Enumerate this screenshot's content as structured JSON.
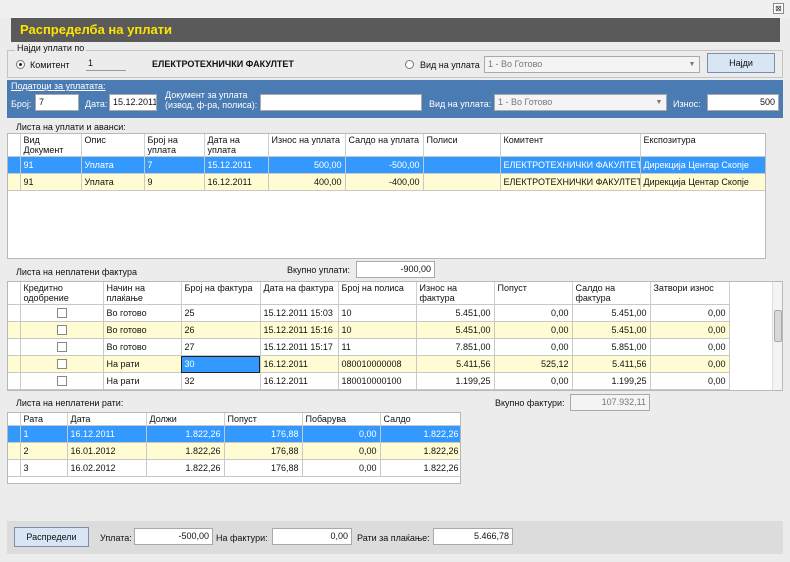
{
  "window": {
    "title": "Распределба на уплати",
    "close": "⊠"
  },
  "search": {
    "group_label": "Најди уплати по",
    "komitent_label": "Комитент",
    "komitent_code": "1",
    "komitent_name": "ЕЛЕКТРОТЕХНИЧКИ ФАКУЛТЕТ",
    "vid_label": "Вид на уплата",
    "vid_value": "1 - Во Готово",
    "find_button": "Најди"
  },
  "payment_data": {
    "link": "Податоци за уплатата:",
    "broj_label": "Број:",
    "broj_value": "7",
    "datum_label": "Дата:",
    "datum_value": "15.12.2011",
    "dokument_label_1": "Документ за уплата",
    "dokument_label_2": "(извод, ф-ра, полиса):",
    "dokument_value": "",
    "vid_label": "Вид на уплата:",
    "vid_value": "1 - Во Готово",
    "iznos_label": "Износ:",
    "iznos_value": "500"
  },
  "payments": {
    "title": "Листа на уплати и аванси:",
    "columns": [
      "Вид Документ",
      "Опис",
      "Број на уплата",
      "Дата на уплата",
      "Износ на уплата",
      "Салдо на уплата",
      "Полиси",
      "Комитент",
      "Експозитура"
    ],
    "rows": [
      [
        "91",
        "Уплата",
        "7",
        "15.12.2011",
        "500,00",
        "-500,00",
        "",
        "ЕЛЕКТРОТЕХНИЧКИ ФАКУЛТЕТ",
        "Дирекција Центар Скопје"
      ],
      [
        "91",
        "Уплата",
        "9",
        "16.12.2011",
        "400,00",
        "-400,00",
        "",
        "ЕЛЕКТРОТЕХНИЧКИ ФАКУЛТЕТ",
        "Дирекција Центар Скопје"
      ]
    ]
  },
  "invoices": {
    "title": "Листа на неплатени фактура",
    "total_payments_label": "Вкупно уплати:",
    "total_payments_value": "-900,00",
    "columns": [
      "Кредитно одобрение",
      "Начин на плаќање",
      "Број на фактура",
      "Дата на фактура",
      "Број на полиса",
      "Износ на фактура",
      "Попуст",
      "Салдо на фактура",
      "Затвори износ"
    ],
    "rows": [
      [
        "",
        "Во готово",
        "25",
        "15.12.2011 15:03",
        "10",
        "5.451,00",
        "0,00",
        "5.451,00",
        "0,00"
      ],
      [
        "",
        "Во готово",
        "26",
        "15.12.2011 15:16",
        "10",
        "5.451,00",
        "0,00",
        "5.451,00",
        "0,00"
      ],
      [
        "",
        "Во готово",
        "27",
        "15.12.2011 15:17",
        "11",
        "7.851,00",
        "0,00",
        "5.851,00",
        "0,00"
      ],
      [
        "",
        "На рати",
        "30",
        "16.12.2011",
        "080010000008",
        "5.411,56",
        "525,12",
        "5.411,56",
        "0,00"
      ],
      [
        "",
        "На рати",
        "32",
        "16.12.2011",
        "180010000100",
        "1.199,25",
        "0,00",
        "1.199,25",
        "0,00"
      ]
    ],
    "total_invoices_label": "Вкупно фактури:",
    "total_invoices_value": "107.932,11"
  },
  "installments": {
    "title": "Листа на неплатени рати:",
    "columns": [
      "Рата",
      "Дата",
      "Должи",
      "Попуст",
      "Побарува",
      "Салдо"
    ],
    "rows": [
      [
        "1",
        "16.12.2011",
        "1.822,26",
        "176,88",
        "0,00",
        "1.822,26"
      ],
      [
        "2",
        "16.01.2012",
        "1.822,26",
        "176,88",
        "0,00",
        "1.822,26"
      ],
      [
        "3",
        "16.02.2012",
        "1.822,26",
        "176,88",
        "0,00",
        "1.822,26"
      ]
    ]
  },
  "footer": {
    "distribute_button": "Распредели",
    "uplata_label": "Уплата:",
    "uplata_value": "-500,00",
    "fakturi_label": "На фактури:",
    "fakturi_value": "0,00",
    "rati_label": "Рати за плаќање:",
    "rati_value": "5.466,78"
  }
}
